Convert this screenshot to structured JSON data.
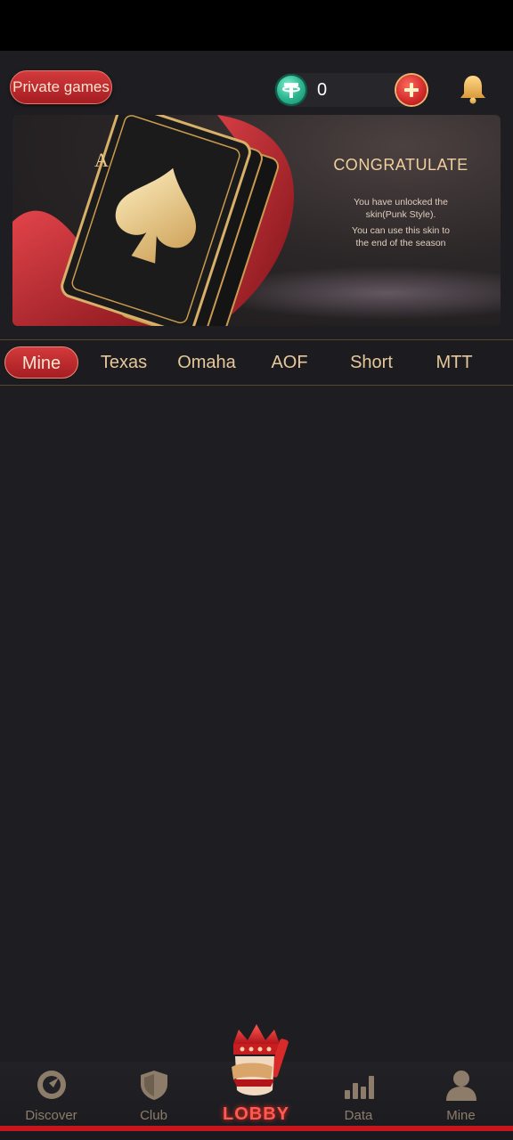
{
  "top_bar": {
    "private_games_label": "Private games",
    "balance": "0",
    "currency_icon": "tether-icon",
    "add_icon": "plus-icon",
    "notification_icon": "bell-icon"
  },
  "banner": {
    "title": "CONGRATULATE",
    "line1": "You have unlocked the",
    "line2": "skin(Punk Style).",
    "line3": "You can use this skin to",
    "line4": "the end of the season"
  },
  "tabs": [
    {
      "label": "Mine",
      "active": true
    },
    {
      "label": "Texas",
      "active": false
    },
    {
      "label": "Omaha",
      "active": false
    },
    {
      "label": "AOF",
      "active": false
    },
    {
      "label": "Short",
      "active": false
    },
    {
      "label": "MTT",
      "active": false
    }
  ],
  "bottom_nav": {
    "items": [
      {
        "label": "Discover",
        "icon": "compass-icon"
      },
      {
        "label": "Club",
        "icon": "shield-icon"
      },
      {
        "label": "LOBBY",
        "icon": "king-icon",
        "active": true
      },
      {
        "label": "Data",
        "icon": "bar-chart-icon"
      },
      {
        "label": "Mine",
        "icon": "user-icon"
      }
    ]
  },
  "colors": {
    "background": "#1e1e22",
    "accent_red": "#c62a2e",
    "gold": "#e6c79a",
    "nav_inactive": "#8c7c69"
  }
}
